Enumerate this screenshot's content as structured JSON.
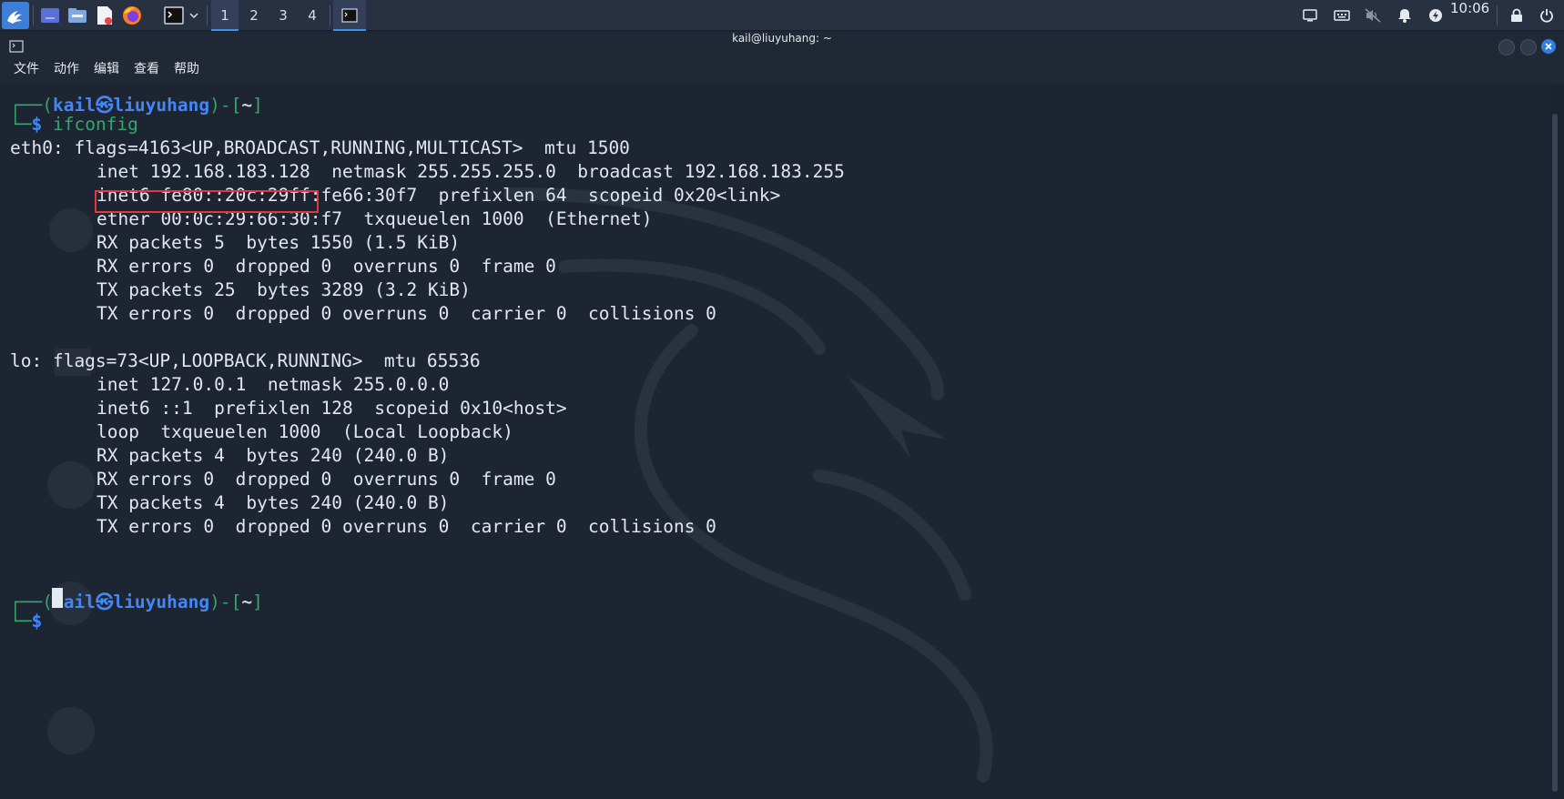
{
  "taskbar": {
    "workspaces": [
      "1",
      "2",
      "3",
      "4"
    ],
    "clock": "10:06",
    "icons": [
      "kali-menu-icon",
      "desktop-icon",
      "file-manager-icon",
      "text-editor-icon",
      "firefox-icon",
      "terminal-icon",
      "chevron-down-icon",
      "terminal-window-icon",
      "screen-icon",
      "keyboard-icon",
      "mute-icon",
      "bell-icon",
      "power-icon",
      "lock-icon",
      "power-off-icon"
    ]
  },
  "window": {
    "title": "kail@liuyuhang: ~",
    "menu": [
      "文件",
      "动作",
      "编辑",
      "查看",
      "帮助"
    ],
    "buttons": {
      "minimize": "minimize-button",
      "maximize": "maximize-button",
      "close": "close-button"
    }
  },
  "terminal": {
    "prompt1": {
      "lead": "┌──(",
      "user": "kail",
      "at": "㉿",
      "host": "liuyuhang",
      "mid": ")-[",
      "dir": "~",
      "end": "]",
      "lead2": "└─",
      "dollar": "$",
      "command": "ifconfig"
    },
    "eth0": {
      "header": "eth0: flags=4163<UP,BROADCAST,RUNNING,MULTICAST>  mtu 1500",
      "inet": "inet 192.168.183.128",
      "inet_rest": "  netmask 255.255.255.0  broadcast 192.168.183.255",
      "lines": [
        "inet6 fe80::20c:29ff:fe66:30f7  prefixlen 64  scopeid 0x20<link>",
        "ether 00:0c:29:66:30:f7  txqueuelen 1000  (Ethernet)",
        "RX packets 5  bytes 1550 (1.5 KiB)",
        "RX errors 0  dropped 0  overruns 0  frame 0",
        "TX packets 25  bytes 3289 (3.2 KiB)",
        "TX errors 0  dropped 0 overruns 0  carrier 0  collisions 0"
      ]
    },
    "lo": {
      "header": "lo: flags=73<UP,LOOPBACK,RUNNING>  mtu 65536",
      "lines": [
        "inet 127.0.0.1  netmask 255.0.0.0",
        "inet6 ::1  prefixlen 128  scopeid 0x10<host>",
        "loop  txqueuelen 1000  (Local Loopback)",
        "RX packets 4  bytes 240 (240.0 B)",
        "RX errors 0  dropped 0  overruns 0  frame 0",
        "TX packets 4  bytes 240 (240.0 B)",
        "TX errors 0  dropped 0 overruns 0  carrier 0  collisions 0"
      ]
    },
    "prompt2": {
      "lead": "┌──(",
      "user": "kail",
      "at": "㉿",
      "host": "liuyuhang",
      "mid": ")-[",
      "dir": "~",
      "end": "]",
      "lead2": "└─",
      "dollar": "$",
      "command": ""
    }
  },
  "colors": {
    "highlight_box": "#e2373d",
    "prompt_green": "#35a66a",
    "prompt_blue": "#4287f5",
    "accent": "#3d8fe8"
  }
}
